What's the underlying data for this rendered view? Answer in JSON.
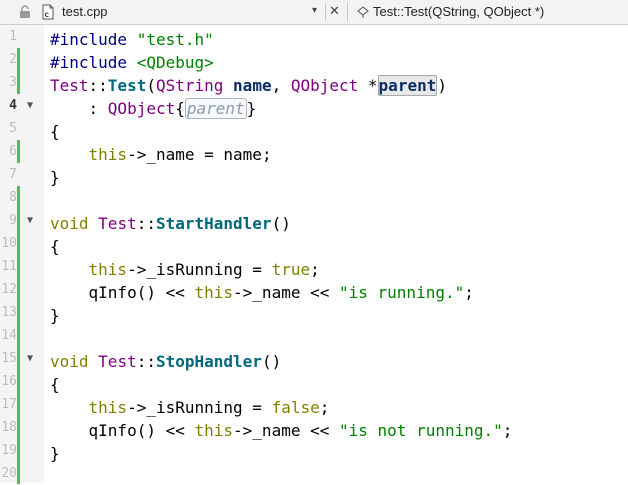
{
  "tab": {
    "filename": "test.cpp",
    "breadcrumb": "Test::Test(QString, QObject *)",
    "dropdown_glyph": "▾",
    "close_glyph": "✕",
    "icons": [
      "lock-icon",
      "cpp-file-icon",
      "function-symbol-icon"
    ]
  },
  "gutter": {
    "line_numbers": [
      "1",
      "2",
      "3",
      "4",
      "5",
      "6",
      "7",
      "8",
      "9",
      "10",
      "11",
      "12",
      "13",
      "14",
      "15",
      "16",
      "17",
      "18",
      "19",
      "20"
    ],
    "current_line": "4",
    "fold_markers_on_lines": [
      "4",
      "9",
      "15"
    ],
    "fold_glyph": "▼",
    "changed_lines": [
      "2",
      "3",
      "6",
      "8",
      "9",
      "10",
      "11",
      "12",
      "13",
      "14",
      "15",
      "16",
      "17",
      "18",
      "19",
      "20"
    ]
  },
  "code": {
    "l1": {
      "a": "#include ",
      "b": "\"test.h\""
    },
    "l2": {
      "a": "#include ",
      "b": "<QDebug>"
    },
    "l3": {
      "a": "Test",
      "b": "::",
      "c": "Test",
      "d": "(",
      "e": "QString",
      "f": " ",
      "g": "name",
      "h": ", ",
      "i": "QObject",
      "j": " *",
      "k": "parent",
      "l": ")"
    },
    "l4": {
      "a": "    : ",
      "b": "QObject",
      "c": "{",
      "d": "parent",
      "e": "}"
    },
    "l5": {
      "a": "{"
    },
    "l6": {
      "a": "    this",
      "b": "->",
      "c": "_name",
      "d": " = ",
      "e": "name",
      "f": ";"
    },
    "l7": {
      "a": "}"
    },
    "l8": {
      "a": ""
    },
    "l9": {
      "a": "void ",
      "b": "Test",
      "c": "::",
      "d": "StartHandler",
      "e": "()"
    },
    "l10": {
      "a": "{"
    },
    "l11": {
      "a": "    this",
      "b": "->",
      "c": "_isRunning",
      "d": " = ",
      "e": "true",
      "f": ";"
    },
    "l12": {
      "a": "    qInfo",
      "b": "() << ",
      "c": "this",
      "d": "->",
      "e": "_name",
      "f": " << ",
      "g": "\"is running.\"",
      "h": ";"
    },
    "l13": {
      "a": "}"
    },
    "l14": {
      "a": ""
    },
    "l15": {
      "a": "void ",
      "b": "Test",
      "c": "::",
      "d": "StopHandler",
      "e": "()"
    },
    "l16": {
      "a": "{"
    },
    "l17": {
      "a": "    this",
      "b": "->",
      "c": "_isRunning",
      "d": " = ",
      "e": "false",
      "f": ";"
    },
    "l18": {
      "a": "    qInfo",
      "b": "() << ",
      "c": "this",
      "d": "->",
      "e": "_name",
      "f": " << ",
      "g": "\"is not running.\"",
      "h": ";"
    },
    "l19": {
      "a": "}"
    },
    "l20": {
      "a": ""
    }
  }
}
